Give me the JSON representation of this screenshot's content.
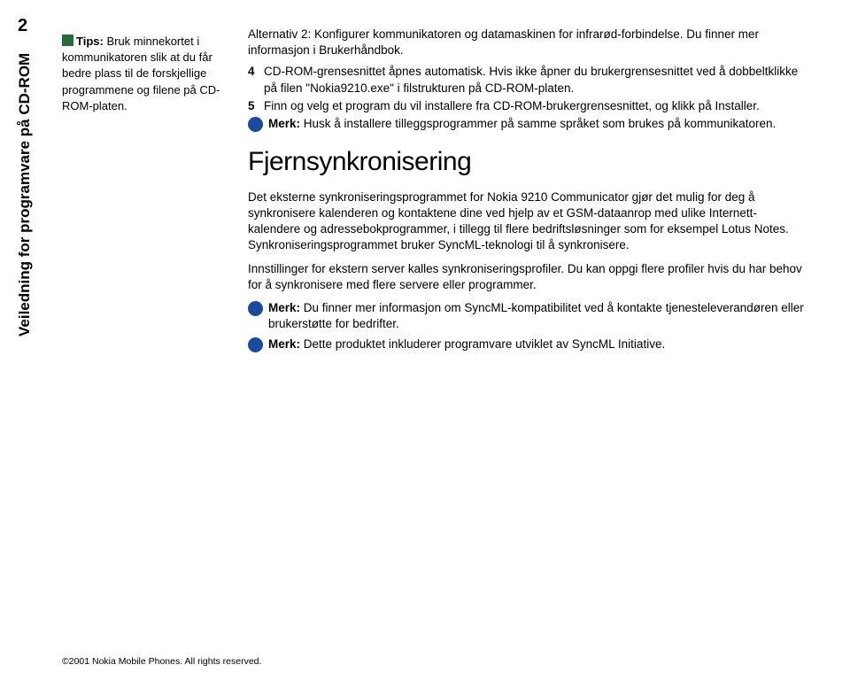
{
  "page_number": "2",
  "vertical_title": "Veiledning for programvare på CD-ROM",
  "sidebar": {
    "tips_label": "Tips:",
    "tips_text": " Bruk minnekortet i kommunikatoren slik at du får bedre plass til de forskjellige programmene og filene på CD-ROM-platen."
  },
  "main": {
    "intro": "Alternativ 2: Konfigurer kommunikatoren og datamaskinen for infrarød-forbindelse. Du finner mer informasjon i Brukerhåndbok.",
    "step4_num": "4",
    "step4": "CD-ROM-grensesnittet åpnes automatisk. Hvis ikke åpner du brukergrensesnittet ved å dobbeltklikke på filen \"Nokia9210.exe\" i filstrukturen på CD-ROM-platen.",
    "step5_num": "5",
    "step5": "Finn og velg et program du vil installere fra CD-ROM-brukergrensesnittet, og klikk på Installer.",
    "note1_label": "Merk:",
    "note1": " Husk å installere tilleggsprogrammer på samme språket som brukes på kommunikatoren.",
    "section_title": "Fjernsynkronisering",
    "para1": "Det eksterne synkroniseringsprogrammet for Nokia 9210 Communicator gjør det mulig for deg å synkronisere kalenderen og kontaktene dine ved hjelp av et GSM-dataanrop med ulike Internett-kalendere og adressebokprogrammer, i tillegg til flere bedriftsløsninger som for eksempel Lotus Notes. Synkroniseringsprogrammet bruker SyncML-teknologi til å synkronisere.",
    "para2": "Innstillinger for ekstern server kalles synkroniseringsprofiler. Du kan oppgi flere profiler hvis du har behov for å synkronisere med flere servere eller programmer.",
    "note2_label": "Merk:",
    "note2": " Du finner mer informasjon om SyncML-kompatibilitet ved å kontakte tjenesteleverandøren eller brukerstøtte for bedrifter.",
    "note3_label": "Merk:",
    "note3": " Dette produktet inkluderer programvare utviklet av SyncML Initiative."
  },
  "footer": "©2001 Nokia Mobile Phones. All rights reserved."
}
